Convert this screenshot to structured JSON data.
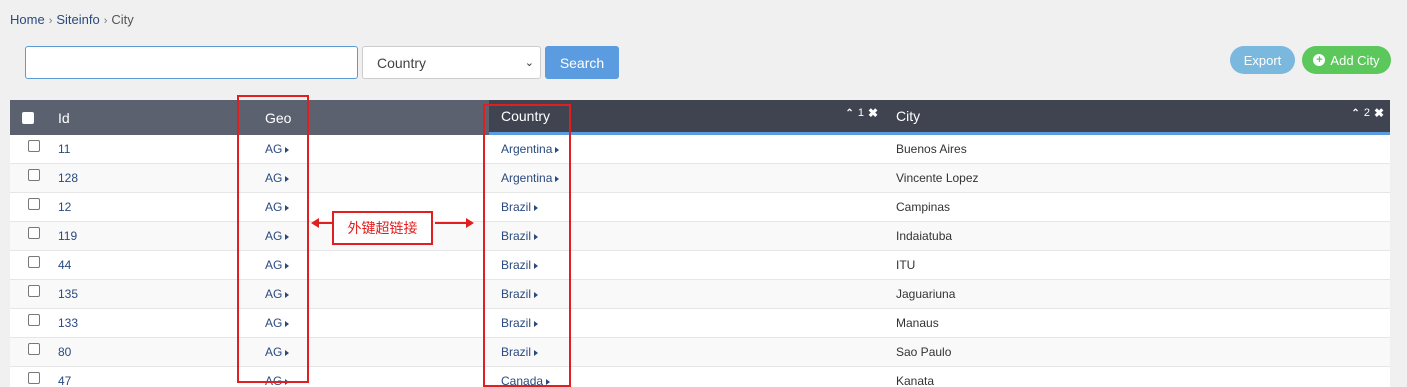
{
  "breadcrumb": {
    "home": "Home",
    "siteinfo": "Siteinfo",
    "current": "City",
    "sep": "›"
  },
  "search": {
    "value": "",
    "placeholder": "",
    "button": "Search"
  },
  "country_filter": {
    "selected": "Country"
  },
  "actions": {
    "export": "Export",
    "add": "Add City"
  },
  "table": {
    "headers": {
      "id": "Id",
      "geo": "Geo",
      "country": "Country",
      "city": "City"
    },
    "sort": {
      "country_order": "1",
      "city_order": "2"
    },
    "rows": [
      {
        "id": "11",
        "geo": "AG",
        "country": "Argentina",
        "city": "Buenos Aires"
      },
      {
        "id": "128",
        "geo": "AG",
        "country": "Argentina",
        "city": "Vincente Lopez"
      },
      {
        "id": "12",
        "geo": "AG",
        "country": "Brazil",
        "city": "Campinas"
      },
      {
        "id": "119",
        "geo": "AG",
        "country": "Brazil",
        "city": "Indaiatuba"
      },
      {
        "id": "44",
        "geo": "AG",
        "country": "Brazil",
        "city": "ITU"
      },
      {
        "id": "135",
        "geo": "AG",
        "country": "Brazil",
        "city": "Jaguariuna"
      },
      {
        "id": "133",
        "geo": "AG",
        "country": "Brazil",
        "city": "Manaus"
      },
      {
        "id": "80",
        "geo": "AG",
        "country": "Brazil",
        "city": "Sao Paulo"
      },
      {
        "id": "47",
        "geo": "AG",
        "country": "Canada",
        "city": "Kanata"
      }
    ]
  },
  "annotation": {
    "label": "外键超链接"
  },
  "colors": {
    "accent": "#5b9bdf",
    "add": "#5cc85c",
    "export": "#7ab8de",
    "annotation": "#e02020"
  }
}
